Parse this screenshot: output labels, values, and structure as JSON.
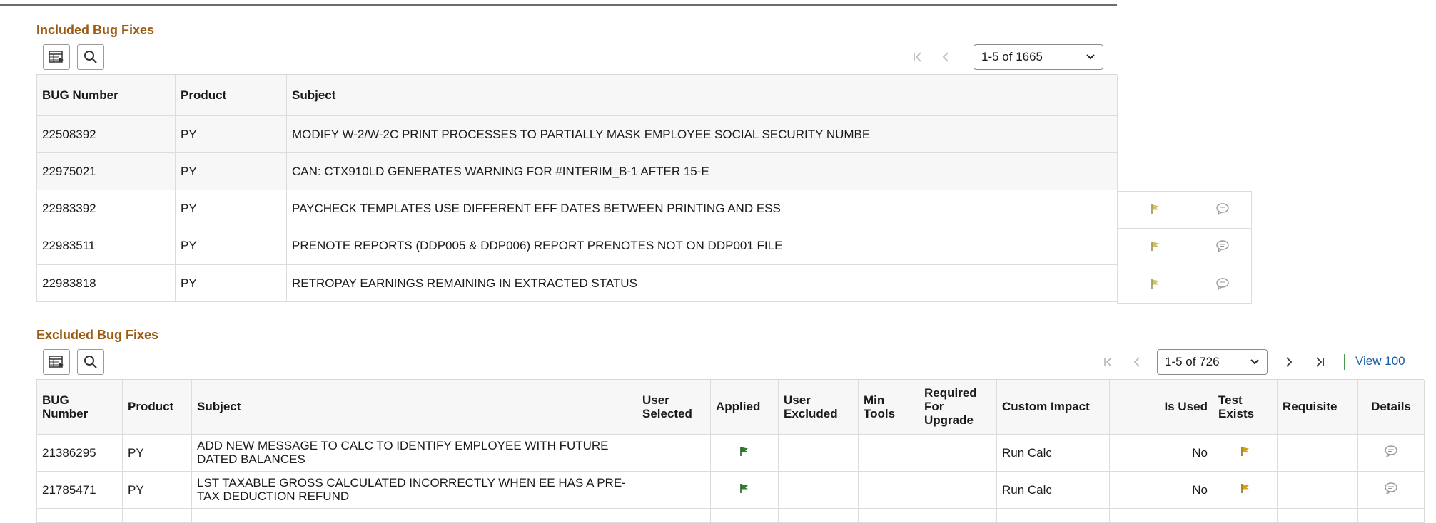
{
  "included": {
    "title": "Included Bug Fixes",
    "pager": "1-5 of 1665",
    "columns": [
      "BUG Number",
      "Product",
      "Subject"
    ],
    "rows": [
      {
        "bug": "22508392",
        "product": "PY",
        "subject": "MODIFY W-2/W-2C PRINT PROCESSES TO PARTIALLY MASK EMPLOYEE SOCIAL SECURITY NUMBE"
      },
      {
        "bug": "22975021",
        "product": "PY",
        "subject": "CAN: CTX910LD GENERATES WARNING FOR #INTERIM_B-1 AFTER 15-E"
      },
      {
        "bug": "22983392",
        "product": "PY",
        "subject": "PAYCHECK TEMPLATES USE DIFFERENT EFF DATES BETWEEN PRINTING AND ESS"
      },
      {
        "bug": "22983511",
        "product": "PY",
        "subject": "PRENOTE REPORTS (DDP005 & DDP006) REPORT PRENOTES NOT ON DDP001 FILE"
      },
      {
        "bug": "22983818",
        "product": "PY",
        "subject": "RETROPAY EARNINGS REMAINING IN EXTRACTED STATUS"
      }
    ]
  },
  "excluded": {
    "title": "Excluded Bug Fixes",
    "pager": "1-5 of 726",
    "view_all": "View 100",
    "columns": {
      "bug": "BUG Number",
      "product": "Product",
      "subject": "Subject",
      "user_selected": "User Selected",
      "applied": "Applied",
      "user_excluded": "User Excluded",
      "min_tools": "Min Tools",
      "required": "Required For Upgrade",
      "custom_impact": "Custom Impact",
      "is_used": "Is Used",
      "test_exists": "Test Exists",
      "requisite": "Requisite",
      "details": "Details"
    },
    "rows": [
      {
        "bug": "21386295",
        "product": "PY",
        "subject": "ADD NEW MESSAGE TO CALC TO IDENTIFY EMPLOYEE WITH FUTURE DATED BALANCES",
        "custom_impact": "Run Calc",
        "is_used": "No"
      },
      {
        "bug": "21785471",
        "product": "PY",
        "subject": "LST TAXABLE GROSS CALCULATED INCORRECTLY WHEN EE HAS A PRE-TAX DEDUCTION REFUND",
        "custom_impact": "Run Calc",
        "is_used": "No"
      }
    ]
  },
  "colors": {
    "section_title": "#9a5a12",
    "link": "#1a5ea8",
    "applied_flag": "#2e7d32",
    "test_flag": "#d4a21a",
    "pale_flag": "#cfc06a"
  }
}
